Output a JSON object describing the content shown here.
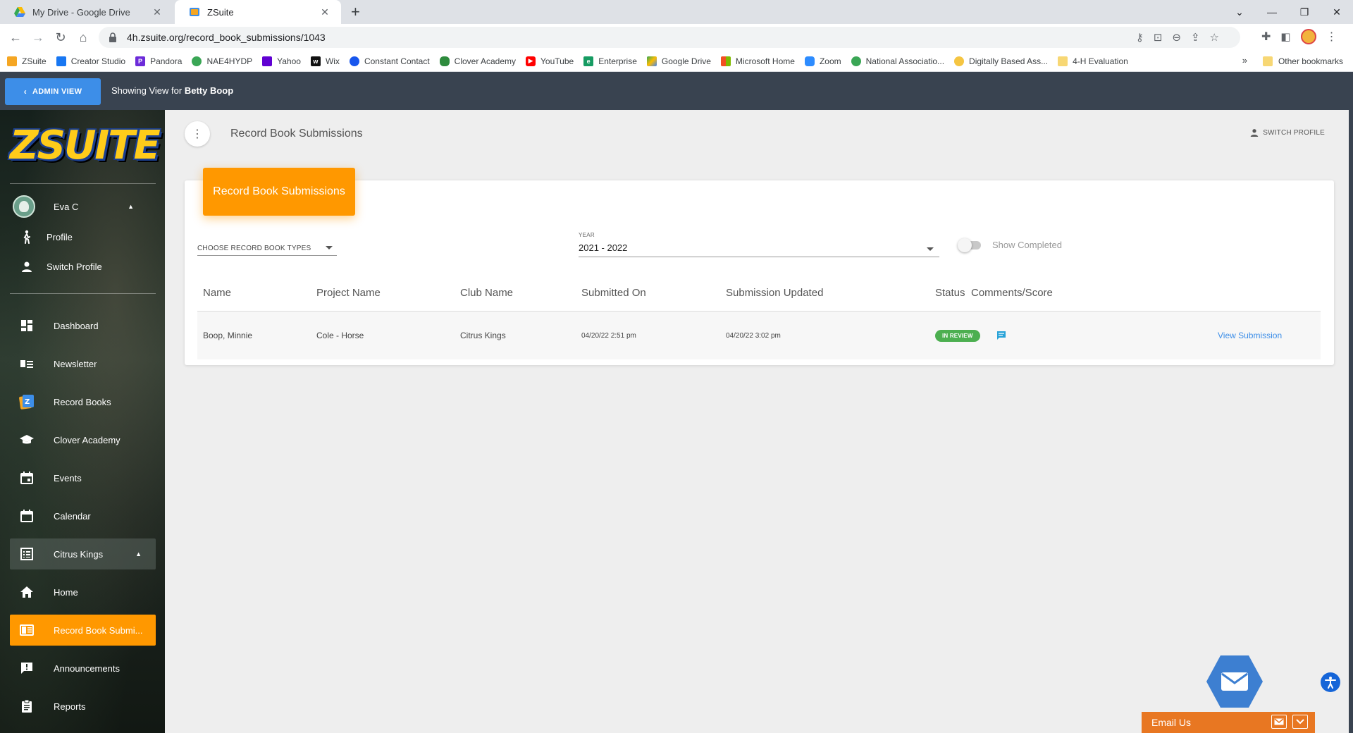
{
  "browser": {
    "tabs": [
      {
        "title": "My Drive - Google Drive"
      },
      {
        "title": "ZSuite"
      }
    ],
    "url": "4h.zsuite.org/record_book_submissions/1043",
    "bookmarks": [
      {
        "label": "ZSuite",
        "color": "#f5a623"
      },
      {
        "label": "Creator Studio",
        "color": "#1877f2"
      },
      {
        "label": "Pandora",
        "color": "#6c2bd9"
      },
      {
        "label": "NAE4HYDP",
        "color": "#3aa655"
      },
      {
        "label": "Yahoo",
        "color": "#6001d2"
      },
      {
        "label": "Wix",
        "color": "#111111"
      },
      {
        "label": "Constant Contact",
        "color": "#1856ed"
      },
      {
        "label": "Clover Academy",
        "color": "#2e8b3d"
      },
      {
        "label": "YouTube",
        "color": "#ff0000"
      },
      {
        "label": "Enterprise",
        "color": "#169b62"
      },
      {
        "label": "Google Drive",
        "color": "#fbbc04"
      },
      {
        "label": "Microsoft Home",
        "color": "#f25022"
      },
      {
        "label": "Zoom",
        "color": "#2d8cff"
      },
      {
        "label": "National Associatio...",
        "color": "#3aa655"
      },
      {
        "label": "Digitally Based Ass...",
        "color": "#f5c542"
      },
      {
        "label": "4-H Evaluation",
        "color": "#f7d774"
      }
    ],
    "more_bookmarks": "»",
    "other_bookmarks": "Other bookmarks"
  },
  "header": {
    "admin_view_label": "ADMIN VIEW",
    "showing_prefix": "Showing View for",
    "showing_user": "Betty Boop"
  },
  "sidebar": {
    "logo": "ZSUITE",
    "user_name": "Eva C",
    "profile_label": "Profile",
    "switch_profile_label": "Switch Profile",
    "items": [
      {
        "label": "Dashboard",
        "icon": "dashboard-icon"
      },
      {
        "label": "Newsletter",
        "icon": "newsletter-icon"
      },
      {
        "label": "Record Books",
        "icon": "record-books-icon"
      },
      {
        "label": "Clover Academy",
        "icon": "graduation-cap-icon"
      },
      {
        "label": "Events",
        "icon": "event-icon"
      },
      {
        "label": "Calendar",
        "icon": "calendar-icon"
      },
      {
        "label": "Citrus Kings",
        "icon": "list-icon"
      },
      {
        "label": "Home",
        "icon": "home-icon"
      },
      {
        "label": "Record Book Submi...",
        "icon": "book-icon"
      },
      {
        "label": "Announcements",
        "icon": "announcement-icon"
      },
      {
        "label": "Reports",
        "icon": "clipboard-icon"
      }
    ]
  },
  "main": {
    "page_title": "Record Book Submissions",
    "switch_profile": "SWITCH PROFILE",
    "card_title": "Record Book Submissions",
    "filters": {
      "record_book_types_placeholder": "CHOOSE RECORD BOOK TYPES",
      "year_label": "YEAR",
      "year_value": "2021 - 2022",
      "show_completed_label": "Show Completed"
    },
    "table": {
      "columns": [
        "Name",
        "Project Name",
        "Club Name",
        "Submitted On",
        "Submission Updated",
        "Status",
        "Comments/Score"
      ],
      "rows": [
        {
          "name": "Boop, Minnie",
          "project": "Cole - Horse",
          "club": "Citrus Kings",
          "submitted_on": "04/20/22 2:51 pm",
          "updated": "04/20/22 3:02 pm",
          "status": "IN REVIEW",
          "action": "View Submission"
        }
      ]
    }
  },
  "widgets": {
    "email_us": "Email Us"
  },
  "colors": {
    "accent_orange": "#ff9800",
    "admin_blue": "#3d8ee8",
    "status_green": "#4caf50",
    "header_dark": "#394350"
  }
}
